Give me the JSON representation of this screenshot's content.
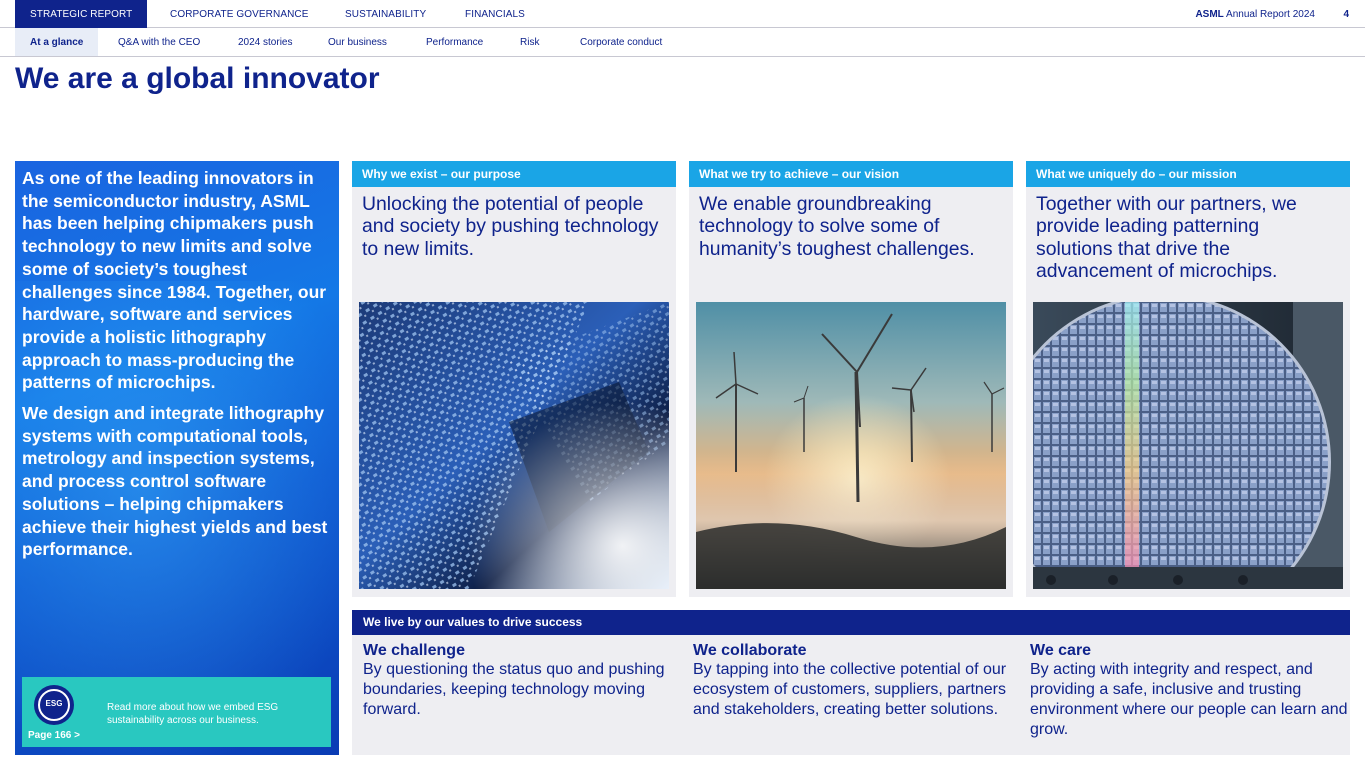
{
  "top_nav": {
    "tabs": [
      "STRATEGIC REPORT",
      "CORPORATE GOVERNANCE",
      "SUSTAINABILITY",
      "FINANCIALS"
    ],
    "report_brand": "ASML",
    "report_title": "Annual Report 2024",
    "page_number": "4"
  },
  "sub_nav": {
    "tabs": [
      "At a glance",
      "Q&A with the CEO",
      "2024 stories",
      "Our business",
      "Performance",
      "Risk",
      "Corporate conduct"
    ]
  },
  "page_title": "We are a global innovator",
  "intro": {
    "paragraph1": "As one of the leading innovators in the semiconductor industry, ASML has been helping chipmakers push technology to new limits and solve some of society’s toughest challenges since 1984. Together, our hardware, software and services provide a holistic lithography approach to mass-producing the patterns of microchips.",
    "paragraph2": "We design and integrate lithography systems with computational tools, metrology and inspection systems, and process control software solutions – helping chipmakers achieve their highest yields and best performance."
  },
  "esg": {
    "badge": "ESG",
    "text": "Read more about how we embed ESG sustainability across our business.",
    "link": "Page 166 >"
  },
  "columns": [
    {
      "header": "Why we exist – our purpose",
      "text": "Unlocking the potential of people and society by pushing technology to new limits.",
      "image": "circuit-board-photo"
    },
    {
      "header": "What we try to achieve – our vision",
      "text": "We enable groundbreaking technology to solve some of humanity’s toughest challenges.",
      "image": "wind-turbines-photo"
    },
    {
      "header": "What we uniquely do – our mission",
      "text": "Together with our partners, we provide leading patterning solutions that drive the advancement of microchips.",
      "image": "silicon-wafer-photo"
    }
  ],
  "values": {
    "header": "We live by our values to drive success",
    "items": [
      {
        "title": "We challenge",
        "text": "By questioning the status quo and pushing boundaries, keeping technology moving forward."
      },
      {
        "title": "We collaborate",
        "text": "By tapping into the collective potential of our ecosystem of customers, suppliers, partners and stakeholders, creating better solutions."
      },
      {
        "title": "We care",
        "text": "By acting with integrity and respect, and providing a safe, inclusive and trusting environment where our people can learn and grow."
      }
    ]
  },
  "colors": {
    "brand_navy": "#0f238c",
    "accent_blue": "#1aa5e6",
    "esg_teal": "#29c8c0"
  }
}
